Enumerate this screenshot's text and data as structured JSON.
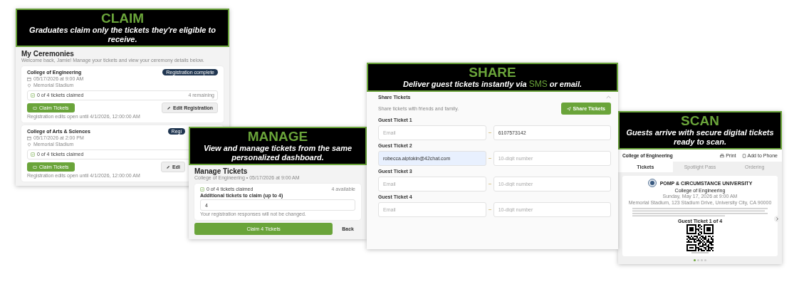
{
  "claim": {
    "banner": {
      "title": "CLAIM",
      "subtitle": "Graduates claim only the tickets they're eligible to receive."
    },
    "title": "My Ceremonies",
    "intro": "Welcome back, Jamie! Manage your tickets and view your ceremony details below.",
    "cards": [
      {
        "name": "College of Engineering",
        "date": "05/17/2026 at 9:00 AM",
        "venue": "Memorial Stadium",
        "badge": "Registration complete",
        "claimed": "0 of 4 tickets claimed",
        "remaining": "4 remaining",
        "claim_button": "Claim Tickets",
        "edit_button": "Edit Registration",
        "note": "Registration edits open until 4/1/2026, 12:00:00 AM"
      },
      {
        "name": "College of Arts & Sciences",
        "date": "05/17/2026 at 2:00 PM",
        "venue": "Memorial Stadium",
        "badge": "Regi",
        "claimed": "0 of 4 tickets claimed",
        "claim_button": "Claim Tickets",
        "edit_button": "Edi",
        "note": "Registration edits open until 4/1/2026, 12:00:00 AM"
      }
    ]
  },
  "manage": {
    "banner": {
      "title": "MANAGE",
      "subtitle": "View and manage tickets from the same personalized dashboard."
    },
    "title": "Manage Tickets",
    "subtitle": "College of Engineering • 05/17/2026 at 9:00 AM",
    "claimed": "0 of 4 tickets claimed",
    "available": "4 available",
    "field_label": "Additional tickets to claim (up to 4)",
    "field_value": "4",
    "hint": "Your registration responses will not be changed.",
    "primary_button": "Claim 4 Tickets",
    "secondary_button": "Back"
  },
  "share": {
    "banner": {
      "title": "SHARE",
      "subtitle": [
        {
          "text": "Deliver guest tickets instantly via ",
          "highlight": false
        },
        {
          "text": "SMS",
          "highlight": true
        },
        {
          "text": " or email.",
          "highlight": false
        }
      ]
    },
    "title": "Share Tickets",
    "expanded": true,
    "description": "Share tickets with friends and family.",
    "button": "Share Tickets",
    "guests": [
      {
        "label": "Guest Ticket 1",
        "email": {
          "placeholder": "Email",
          "autofilled": false
        },
        "phone": {
          "value": "6107573142"
        }
      },
      {
        "label": "Guest Ticket 2",
        "email": {
          "value": "robecca.alptokin@42chat.com",
          "autofilled": true
        },
        "phone": {
          "placeholder": "10-digit number"
        }
      },
      {
        "label": "Guest Ticket 3",
        "email": {
          "placeholder": "Email",
          "autofilled": false
        },
        "phone": {
          "placeholder": "10-digit number"
        }
      },
      {
        "label": "Guest Ticket 4",
        "email": {
          "placeholder": "Email",
          "autofilled": false
        },
        "phone": {
          "placeholder": "10-digit number"
        }
      }
    ]
  },
  "scan": {
    "banner": {
      "title": "SCAN",
      "subtitle": "Guests arrive with secure digital tickets ready to scan."
    },
    "title": "College of Engineering",
    "actions": [
      {
        "label": "Print",
        "kind": "print"
      },
      {
        "label": "Add to Phone",
        "kind": "phone"
      }
    ],
    "tabs": [
      {
        "label": "Tickets",
        "selected": true
      },
      {
        "label": "Spotlight Pass",
        "selected": false
      },
      {
        "label": "Ordering",
        "selected": false
      }
    ],
    "ticket": {
      "university": "POMP & CIRCUMSTANCE UNIVERSITY",
      "ceremony": "College of Engineering",
      "date": "Sunday, May 17, 2026 at 9:00 AM",
      "address": "Memorial Stadium, 123 Stadium Drive, University City, CA 90000",
      "guest_label": "Guest Ticket 1 of 4"
    },
    "pages": [
      {
        "selected": true
      },
      {
        "selected": false
      },
      {
        "selected": false
      },
      {
        "selected": false
      }
    ]
  }
}
